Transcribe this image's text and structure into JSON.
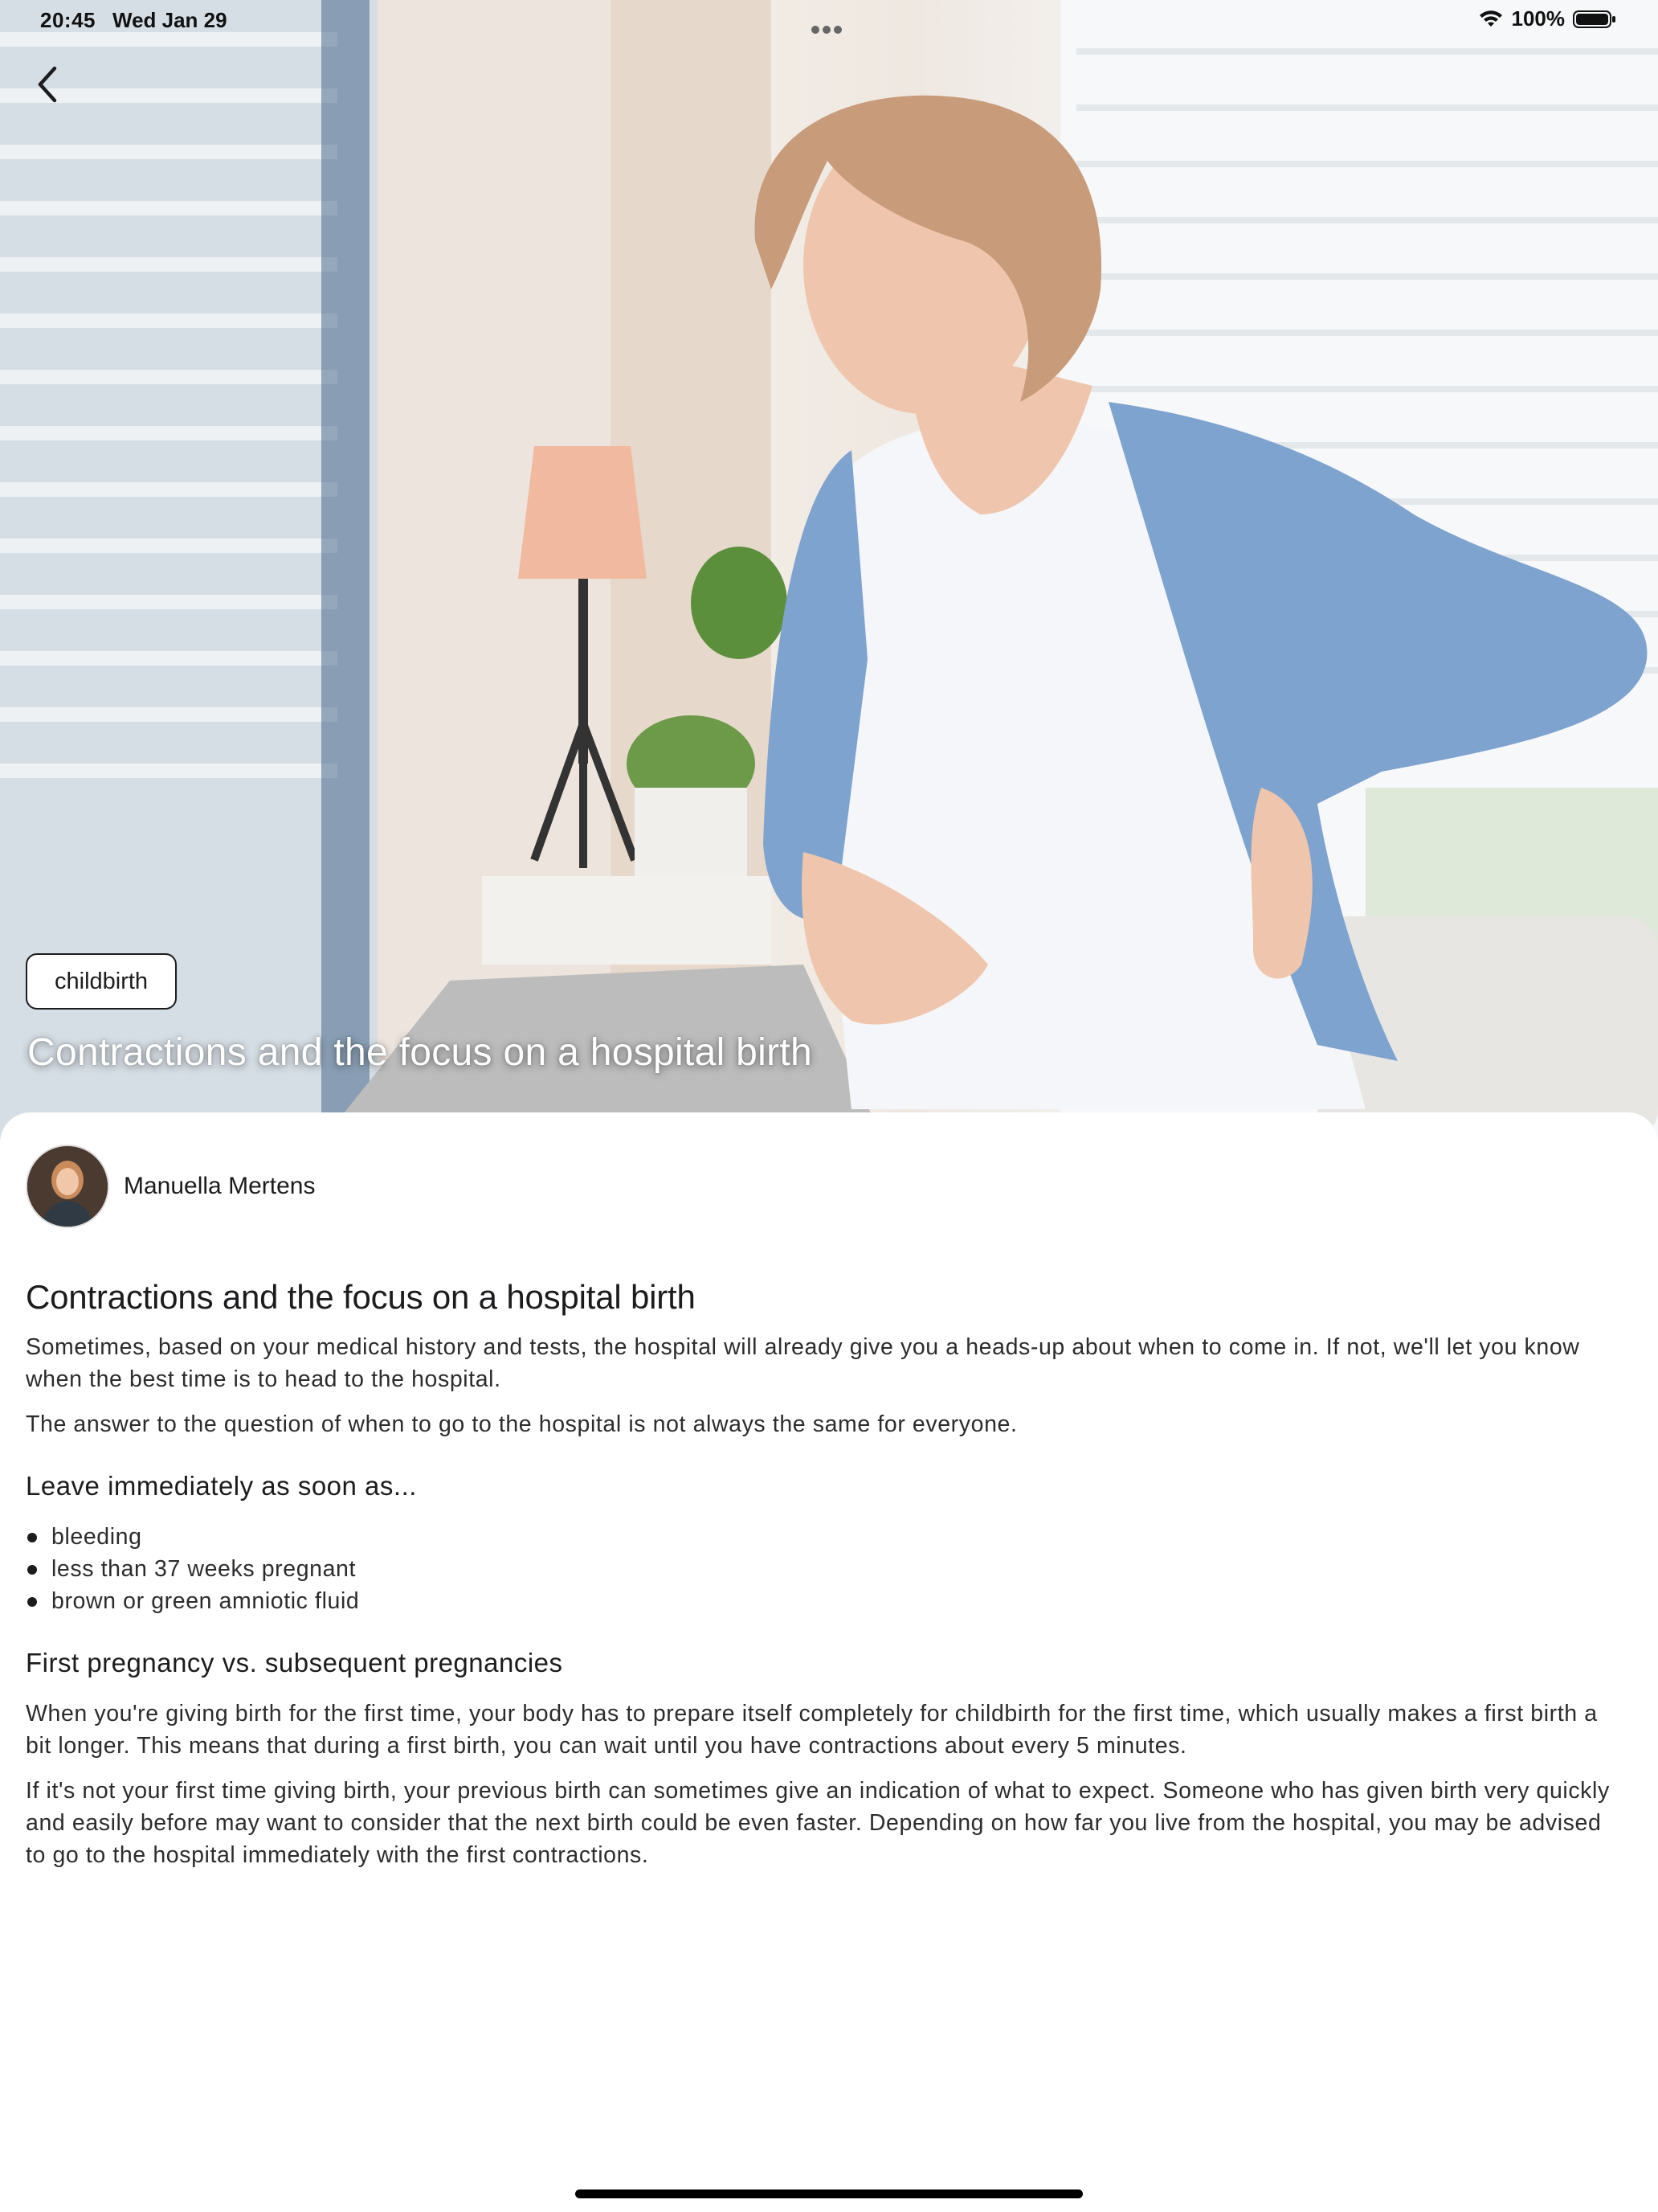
{
  "status_bar": {
    "time": "20:45",
    "date": "Wed Jan 29",
    "battery": "100%"
  },
  "article": {
    "tag": "childbirth",
    "hero_title": "Contractions and the focus on a hospital birth",
    "author": "Manuella Mertens",
    "title": "Contractions and the focus on a hospital birth",
    "intro_paragraphs": [
      "Sometimes, based on your medical history and tests, the hospital will already give you a heads-up about when to come in. If not, we'll let you know when the best time is to head to the hospital.",
      "The answer to the question of when to go to the hospital is not always the same for everyone."
    ],
    "section1": {
      "heading": "Leave immediately as soon as...",
      "bullets": [
        "bleeding",
        "less than 37 weeks pregnant",
        "brown or green amniotic fluid"
      ]
    },
    "section2": {
      "heading": "First pregnancy vs. subsequent pregnancies",
      "paragraphs": [
        "When you're giving birth for the first time, your body has to prepare itself completely for childbirth for the first time, which usually makes a first birth a bit longer. This means that during a first birth, you can wait until you have contractions about every 5 minutes.",
        "If it's not your first time giving birth, your previous birth can sometimes give an indication of what to expect. Someone who has given birth very quickly and easily before may want to consider that the next birth could be even faster. Depending on how far you live from the hospital, you may be advised to go to the hospital immediately with the first contractions."
      ]
    }
  },
  "icons": {
    "back": "chevron-left-icon",
    "wifi": "wifi-icon",
    "battery": "battery-icon",
    "more": "more-dots-icon"
  },
  "colors": {
    "text": "#1c1c1e",
    "cardigan": "#7fa3cf",
    "background": "#ffffff"
  }
}
